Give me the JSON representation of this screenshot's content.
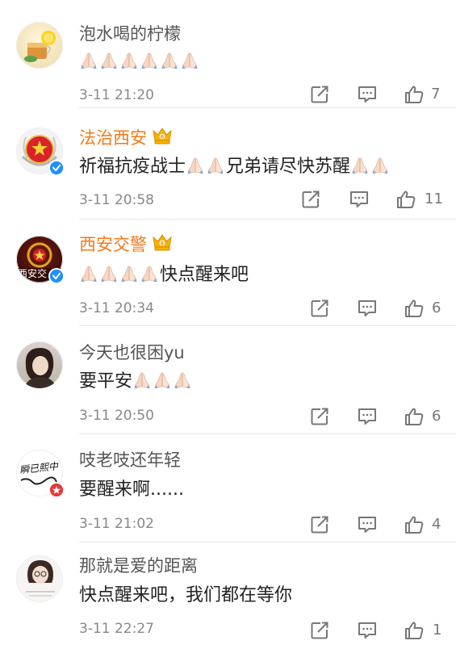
{
  "icons": {
    "repost": "repost-icon",
    "comment": "comment-icon",
    "like": "thumbs-up-icon",
    "verified": "verified-v-icon",
    "crown": "crown-vip-icon",
    "pray": "folded-hands-emoji"
  },
  "colors": {
    "vip_name": "#f27a1a",
    "verified": "#1e90ff",
    "crown": "#f4b400"
  },
  "comments": [
    {
      "name": "泡水喝的柠檬",
      "text": "",
      "time": "3-11 21:20",
      "likes": "7"
    },
    {
      "name": "法治西安",
      "text_a": "祈福抗疫战士",
      "text_b": "兄弟请尽快苏醒",
      "time": "3-11 20:58",
      "likes": "11"
    },
    {
      "name": "西安交警",
      "text": "快点醒来吧",
      "avatar_text": "西安交",
      "time": "3-11 20:34",
      "likes": "6"
    },
    {
      "name": "今天也很困yu",
      "text": "要平安",
      "time": "3-11 20:50",
      "likes": "6"
    },
    {
      "name": "吱老吱还年轻",
      "text": "要醒来啊......",
      "avatar_text": "瞬已熙中",
      "time": "3-11 21:02",
      "likes": "4"
    },
    {
      "name": "那就是爱的距离",
      "text": "快点醒来吧，我们都在等你",
      "time": "3-11 22:27",
      "likes": "1"
    }
  ]
}
